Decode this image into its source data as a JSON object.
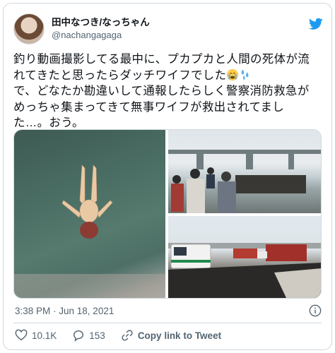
{
  "user": {
    "display_name": "田中なつき/なっちゃん",
    "handle": "@nachangagaga"
  },
  "tweet": {
    "text_line1": "釣り動画撮影してる最中に、プカプカと人間の死体が流",
    "text_line2": "れてきたと思ったらダッチワイフでした",
    "text_line3": "で、どなたか勘違いして通報したらしく警察消防救急が",
    "text_line4": "めっちゃ集まってきて無事ワイフが救出されてまし",
    "text_line5": "た…。おう。",
    "emojis": [
      "crying-face-emoji",
      "sweat-droplets-emoji"
    ]
  },
  "media": {
    "photos": [
      "photo-water-doll",
      "photo-pier-crowd",
      "photo-emergency-vehicles"
    ]
  },
  "timestamp": "3:38 PM · Jun 18, 2021",
  "actions": {
    "likes": "10.1K",
    "replies": "153",
    "copy_link": "Copy link to Tweet"
  },
  "colors": {
    "twitter_blue": "#1d9bf0",
    "secondary_text": "#536471",
    "border": "#cfd9de"
  }
}
